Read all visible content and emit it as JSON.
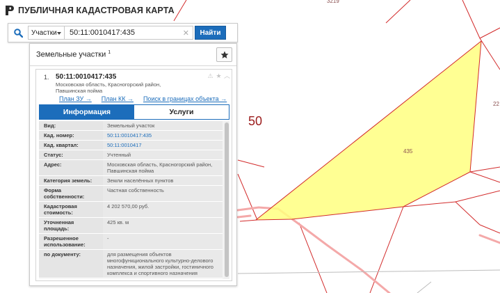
{
  "header": {
    "title": "ПУБЛИЧНАЯ КАДАСТРОВАЯ КАРТА"
  },
  "search": {
    "type_value": "Участки",
    "query": "50:11:0010417:435",
    "find_label": "Найти"
  },
  "map": {
    "region_label": "50",
    "parcel_label": "435",
    "edge_label_top": "3219",
    "edge_label_right": "22",
    "parcel_color": "#ffff80",
    "border_color": "#d22a2a",
    "road_color": "#f4a9a9"
  },
  "panel": {
    "title": "Земельные участки",
    "count": "1",
    "result": {
      "index": "1.",
      "cadnum": "50:11:0010417:435",
      "address": "Московская область, Красногорский район, Павшинская пойма",
      "links": [
        "План ЗУ →",
        "План КК →",
        "Поиск в границах объекта →"
      ]
    },
    "tabs": {
      "info": "Информация",
      "services": "Услуги"
    },
    "rows": [
      {
        "key": "Вид:",
        "value": "Земельный участок",
        "link": false
      },
      {
        "key": "Кад. номер:",
        "value": "50:11:0010417:435",
        "link": true
      },
      {
        "key": "Кад. квартал:",
        "value": "50:11:0010417",
        "link": true
      },
      {
        "key": "Статус:",
        "value": "Учтенный",
        "link": false
      },
      {
        "key": "Адрес:",
        "value": "Московская область, Красногорский район, Павшинская пойма",
        "link": false
      },
      {
        "key": "Категория земель:",
        "value": "Земли населённых пунктов",
        "link": false
      },
      {
        "key": "Форма собственности:",
        "value": "Частная собственность",
        "link": false
      },
      {
        "key": "Кадастровая стоимость:",
        "value": "4 202 570,00 руб.",
        "link": false
      },
      {
        "key": "Уточненная площадь:",
        "value": "425 кв. м",
        "link": false
      },
      {
        "key": "Разрешенное использование:",
        "value": "-",
        "link": false
      },
      {
        "key": "по документу:",
        "value": "для размещения объектов многофункционального культурно-делового назначения, жилой застройки, гостиничного комплекса и спортивного назначения",
        "link": false
      }
    ]
  },
  "colors": {
    "accent": "#1c6dbb"
  }
}
